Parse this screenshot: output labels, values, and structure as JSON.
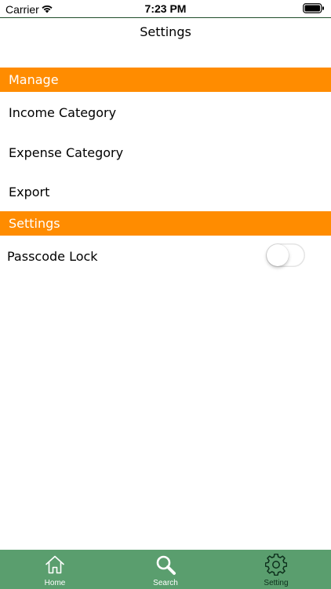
{
  "status_bar": {
    "carrier": "Carrier",
    "time": "7:23 PM",
    "icons": [
      "wifi-icon",
      "battery-icon"
    ]
  },
  "nav": {
    "title": "Settings"
  },
  "sections": {
    "manage": {
      "header": "Manage",
      "items": [
        "Income Category",
        "Expense Category",
        "Export"
      ]
    },
    "settings": {
      "header": "Settings",
      "passcode_label": "Passcode Lock",
      "passcode_enabled": false
    }
  },
  "tab_bar": {
    "tabs": [
      {
        "label": "Home",
        "icon": "home-icon",
        "active": false
      },
      {
        "label": "Search",
        "icon": "search-icon",
        "active": false
      },
      {
        "label": "Setting",
        "icon": "gear-icon",
        "active": true
      }
    ]
  },
  "colors": {
    "section_header_bg": "#ff8c00",
    "tab_bar_bg": "#5a9e6e",
    "tab_active": "#0d2f1c",
    "tab_inactive": "#ffffff"
  }
}
